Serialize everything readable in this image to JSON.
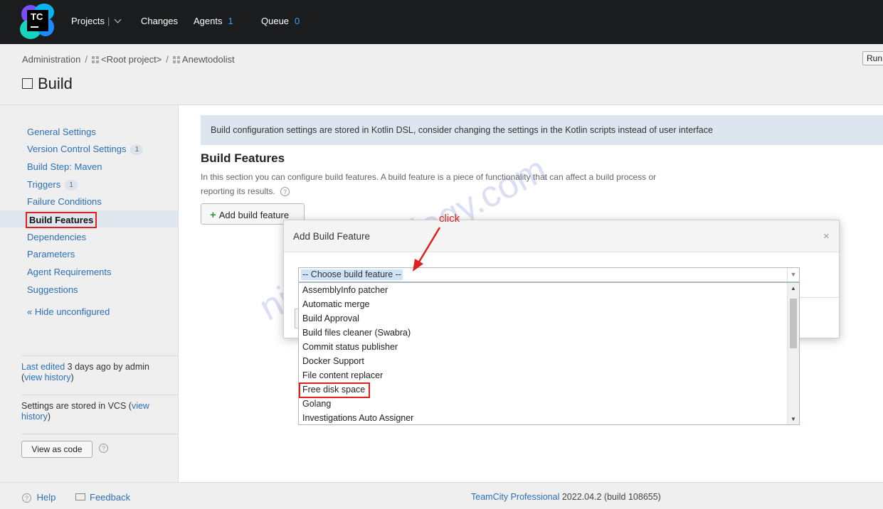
{
  "topnav": {
    "logo_text": "TC",
    "projects": "Projects",
    "changes": "Changes",
    "agents": "Agents",
    "agents_count": "1",
    "queue": "Queue",
    "queue_count": "0"
  },
  "header": {
    "breadcrumb": [
      "Administration",
      "<Root project>",
      "Anewtodolist"
    ],
    "title": "Build",
    "run_label": "Run"
  },
  "sidebar": {
    "items": [
      {
        "label": "General Settings",
        "badge": ""
      },
      {
        "label": "Version Control Settings",
        "badge": "1"
      },
      {
        "label": "Build Step: Maven",
        "badge": ""
      },
      {
        "label": "Triggers",
        "badge": "1"
      },
      {
        "label": "Failure Conditions",
        "badge": ""
      },
      {
        "label": "Build Features",
        "badge": ""
      },
      {
        "label": "Dependencies",
        "badge": ""
      },
      {
        "label": "Parameters",
        "badge": ""
      },
      {
        "label": "Agent Requirements",
        "badge": ""
      },
      {
        "label": "Suggestions",
        "badge": ""
      }
    ],
    "hide_unconfigured": "« Hide unconfigured",
    "last_edited_prefix": "Last edited",
    "last_edited_rest": " 3 days ago by admin",
    "view_history_1": "view history",
    "vcs_text": "Settings are stored in VCS (",
    "view_history_2": "view history",
    "view_as_code": "View as code"
  },
  "main": {
    "banner": "Build configuration settings are stored in Kotlin DSL, consider changing the settings in the Kotlin scripts instead of user interface",
    "section_title": "Build Features",
    "section_desc": "In this section you can configure build features. A build feature is a piece of functionality that can affect a build process or reporting its results.",
    "add_button": "Add build feature"
  },
  "dialog": {
    "title": "Add Build Feature",
    "close": "×",
    "select_value": "-- Choose build feature --",
    "options": [
      "AssemblyInfo patcher",
      "Automatic merge",
      "Build Approval",
      "Build files cleaner (Swabra)",
      "Commit status publisher",
      "Docker Support",
      "File content replacer",
      "Free disk space",
      "Golang",
      "Investigations Auto Assigner"
    ]
  },
  "annotation": {
    "click": "click"
  },
  "watermark": "nimtechnology.com",
  "footer": {
    "help": "Help",
    "feedback": "Feedback",
    "product": "TeamCity Professional",
    "version": " 2022.04.2 (build 108655)"
  },
  "colors": {
    "accent_link": "#2c6fb7",
    "highlight_red": "#e0201c",
    "topbar": "#1b1c1e"
  }
}
